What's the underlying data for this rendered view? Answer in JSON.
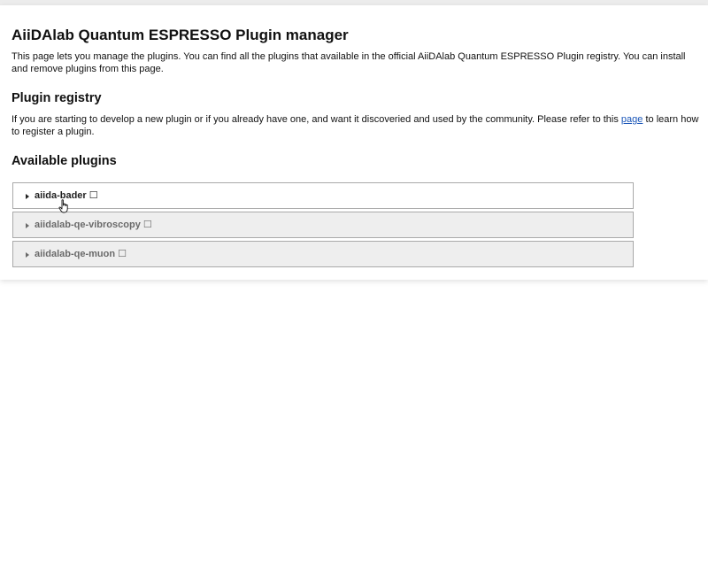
{
  "page": {
    "title": "AiiDAlab Quantum ESPRESSO Plugin manager",
    "intro": "This page lets you manage the plugins. You can find all the plugins that available in the official AiiDAlab Quantum ESPRESSO Plugin registry. You can install and remove plugins from this page."
  },
  "registry": {
    "heading": "Plugin registry",
    "text_before": "If you are starting to develop a new plugin or if you already have one, and want it discoveried and used by the community. Please refer to this ",
    "link_label": "page",
    "text_after": " to learn how to register a plugin."
  },
  "available": {
    "heading": "Available plugins",
    "plugins": [
      {
        "name": "aiida-bader",
        "status": "☐"
      },
      {
        "name": "aiidalab-qe-vibroscopy",
        "status": "☐"
      },
      {
        "name": "aiidalab-qe-muon",
        "status": "☐"
      }
    ]
  },
  "icons": {
    "caret": "caret-right-icon",
    "cursor": "hand-pointer-icon"
  },
  "colors": {
    "link": "#1a56b8",
    "inactive_row_bg": "#eeeeee",
    "row_border": "#a9a9a9"
  }
}
